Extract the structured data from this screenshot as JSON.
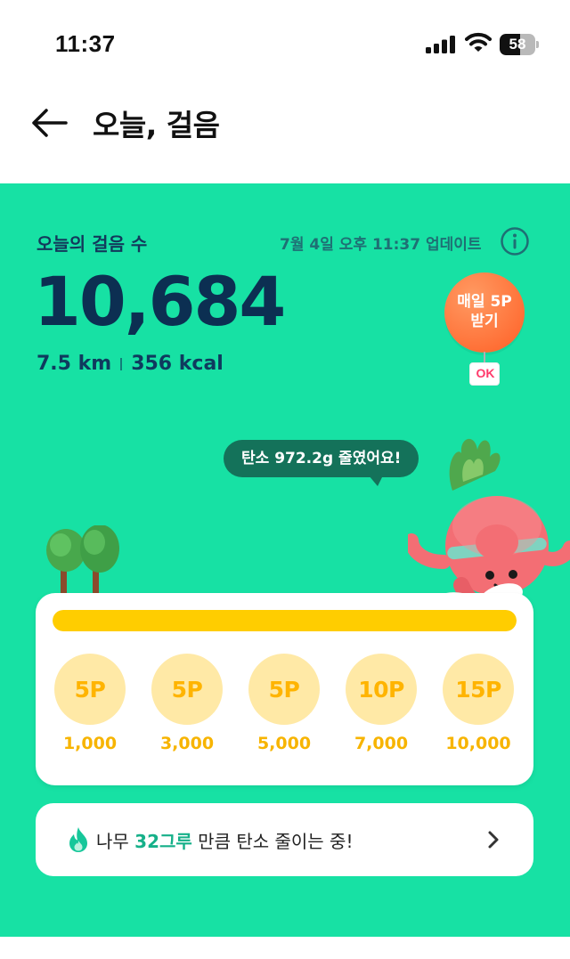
{
  "status_bar": {
    "time": "11:37",
    "battery_percent": 58,
    "battery_label": "58",
    "icons": [
      "signal-icon",
      "wifi-icon",
      "battery-icon"
    ]
  },
  "header": {
    "title": "오늘, 걸음",
    "back_icon": "arrow-left-icon"
  },
  "summary": {
    "label": "오늘의 걸음 수",
    "updated": "7월 4일 오후 11:37 업데이트",
    "steps": "10,684",
    "distance": "7.5 km",
    "calories": "356 kcal",
    "info_icon": "info-circle-icon"
  },
  "bonus": {
    "text": "매일 5P\n받기",
    "badge": "OK"
  },
  "carbon_bubble": "탄소 972.2g 줄였어요!",
  "progress": {
    "fill_fraction": 1.0,
    "milestones": [
      {
        "reward": "5P",
        "steps": "1,000"
      },
      {
        "reward": "5P",
        "steps": "3,000"
      },
      {
        "reward": "5P",
        "steps": "5,000"
      },
      {
        "reward": "10P",
        "steps": "7,000"
      },
      {
        "reward": "15P",
        "steps": "10,000"
      }
    ]
  },
  "carbon_card": {
    "prefix": "나무 ",
    "highlight": "32그루",
    "suffix": " 만큼 탄소 줄이는 중!",
    "icon": "fire-icon"
  },
  "colors": {
    "brand_green": "#17e1a4",
    "progress_yellow": "#ffcd00",
    "bonus_orange": "#ff5f25",
    "steps_navy": "#0c2f52"
  }
}
